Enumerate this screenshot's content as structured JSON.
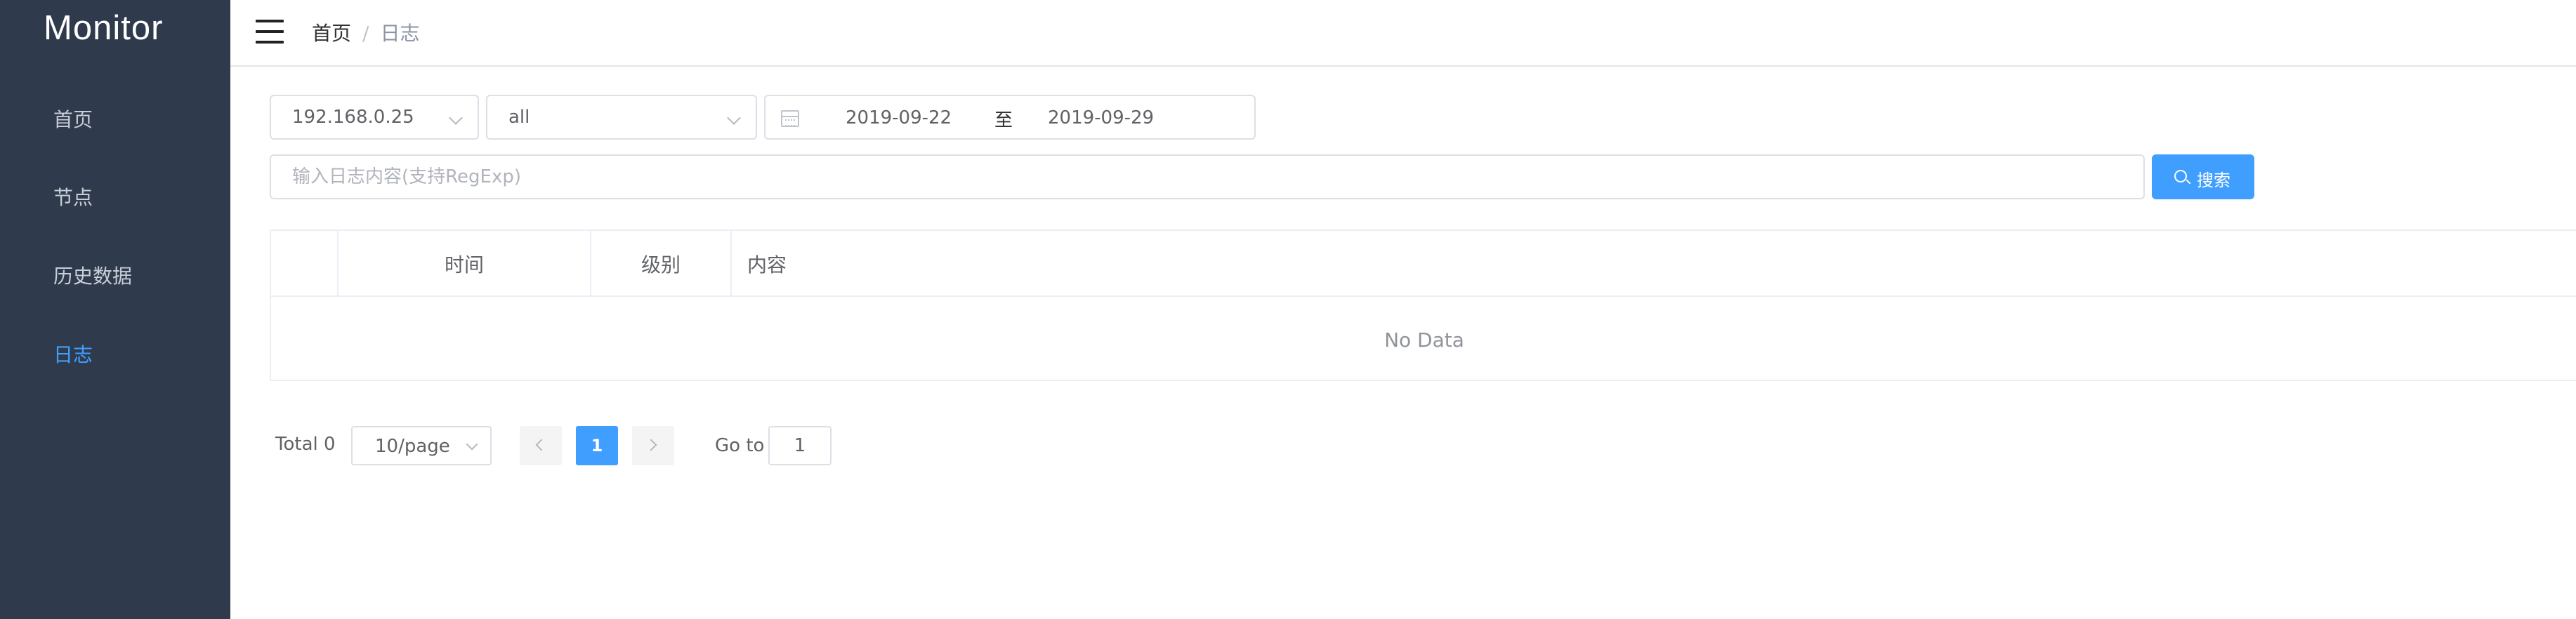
{
  "app": {
    "title": "Monitor"
  },
  "sidebar": {
    "items": [
      {
        "label": "首页",
        "active": false
      },
      {
        "label": "节点",
        "active": false
      },
      {
        "label": "历史数据",
        "active": false
      },
      {
        "label": "日志",
        "active": true
      }
    ]
  },
  "header": {
    "breadcrumb": {
      "home": "首页",
      "separator": "/",
      "current": "日志"
    }
  },
  "filters": {
    "host": {
      "value": "192.168.0.25"
    },
    "level": {
      "value": "all"
    },
    "date_range": {
      "start": "2019-09-22",
      "separator": "至",
      "end": "2019-09-29"
    },
    "search": {
      "placeholder": "输入日志内容(支持RegExp)",
      "value": "",
      "button_label": "搜索"
    }
  },
  "table": {
    "columns": [
      "",
      "时间",
      "级别",
      "内容"
    ],
    "rows": [],
    "empty_text": "No Data"
  },
  "pagination": {
    "total_label": "Total 0",
    "page_size": "10/page",
    "current_page": "1",
    "goto_label": "Go to",
    "goto_value": "1"
  },
  "colors": {
    "sidebar_bg": "#2f3b4c",
    "accent": "#409eff"
  }
}
